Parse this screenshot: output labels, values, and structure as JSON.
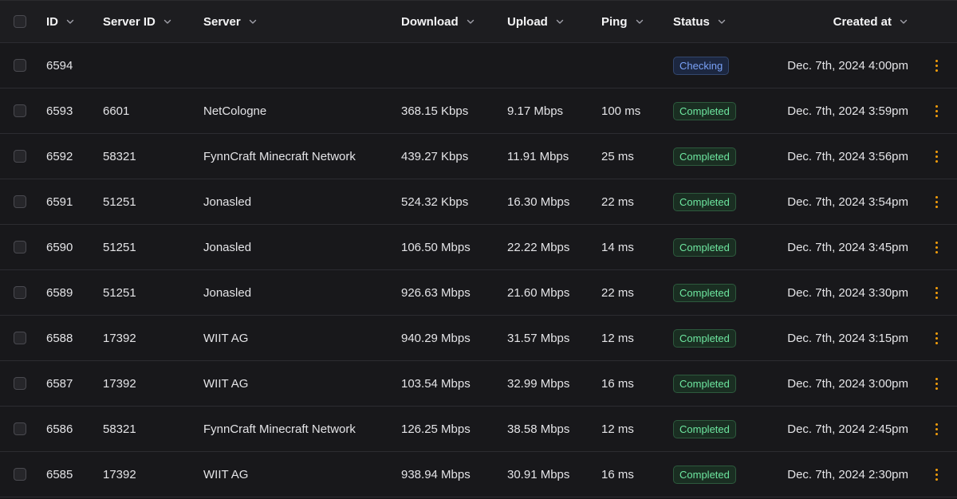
{
  "colors": {
    "accent": "#f59e0b",
    "status_checking": "#7aa2f7",
    "status_completed": "#6ee7a0",
    "background": "#18181b"
  },
  "header": {
    "id": "ID",
    "server_id": "Server ID",
    "server": "Server",
    "download": "Download",
    "upload": "Upload",
    "ping": "Ping",
    "status": "Status",
    "created_at": "Created at"
  },
  "rows": [
    {
      "id": "6594",
      "server_id": "",
      "server": "",
      "download": "",
      "upload": "",
      "ping": "",
      "status": "Checking",
      "created_at": "Dec. 7th, 2024 4:00pm"
    },
    {
      "id": "6593",
      "server_id": "6601",
      "server": "NetCologne",
      "download": "368.15 Kbps",
      "upload": "9.17 Mbps",
      "ping": "100 ms",
      "status": "Completed",
      "created_at": "Dec. 7th, 2024 3:59pm"
    },
    {
      "id": "6592",
      "server_id": "58321",
      "server": "FynnCraft Minecraft Network",
      "download": "439.27 Kbps",
      "upload": "11.91 Mbps",
      "ping": "25 ms",
      "status": "Completed",
      "created_at": "Dec. 7th, 2024 3:56pm"
    },
    {
      "id": "6591",
      "server_id": "51251",
      "server": "Jonasled",
      "download": "524.32 Kbps",
      "upload": "16.30 Mbps",
      "ping": "22 ms",
      "status": "Completed",
      "created_at": "Dec. 7th, 2024 3:54pm"
    },
    {
      "id": "6590",
      "server_id": "51251",
      "server": "Jonasled",
      "download": "106.50 Mbps",
      "upload": "22.22 Mbps",
      "ping": "14 ms",
      "status": "Completed",
      "created_at": "Dec. 7th, 2024 3:45pm"
    },
    {
      "id": "6589",
      "server_id": "51251",
      "server": "Jonasled",
      "download": "926.63 Mbps",
      "upload": "21.60 Mbps",
      "ping": "22 ms",
      "status": "Completed",
      "created_at": "Dec. 7th, 2024 3:30pm"
    },
    {
      "id": "6588",
      "server_id": "17392",
      "server": "WIIT AG",
      "download": "940.29 Mbps",
      "upload": "31.57 Mbps",
      "ping": "12 ms",
      "status": "Completed",
      "created_at": "Dec. 7th, 2024 3:15pm"
    },
    {
      "id": "6587",
      "server_id": "17392",
      "server": "WIIT AG",
      "download": "103.54 Mbps",
      "upload": "32.99 Mbps",
      "ping": "16 ms",
      "status": "Completed",
      "created_at": "Dec. 7th, 2024 3:00pm"
    },
    {
      "id": "6586",
      "server_id": "58321",
      "server": "FynnCraft Minecraft Network",
      "download": "126.25 Mbps",
      "upload": "38.58 Mbps",
      "ping": "12 ms",
      "status": "Completed",
      "created_at": "Dec. 7th, 2024 2:45pm"
    },
    {
      "id": "6585",
      "server_id": "17392",
      "server": "WIIT AG",
      "download": "938.94 Mbps",
      "upload": "30.91 Mbps",
      "ping": "16 ms",
      "status": "Completed",
      "created_at": "Dec. 7th, 2024 2:30pm"
    }
  ]
}
